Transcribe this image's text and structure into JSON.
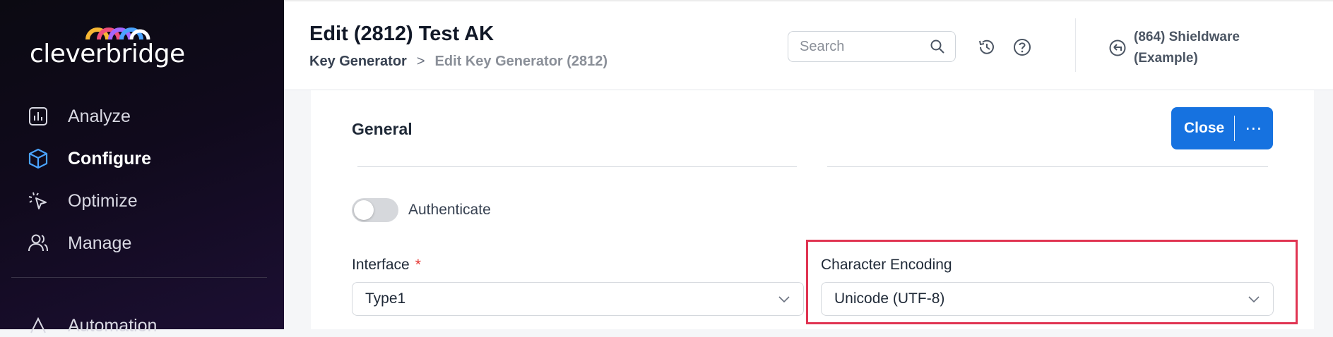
{
  "sidebar": {
    "logo_text": "cleverbridge",
    "items": [
      {
        "label": "Analyze",
        "icon": "bar-chart-icon"
      },
      {
        "label": "Configure",
        "icon": "cube-icon"
      },
      {
        "label": "Optimize",
        "icon": "cursor-click-icon"
      },
      {
        "label": "Manage",
        "icon": "users-icon"
      }
    ],
    "partial_item": "Automation"
  },
  "header": {
    "title": "Edit (2812) Test AK",
    "breadcrumb": [
      "Key Generator",
      "Edit Key Generator (2812)"
    ],
    "breadcrumb_sep": ">",
    "search_placeholder": "Search",
    "account_line1": "(864) Shieldware",
    "account_line2": "(Example)"
  },
  "form": {
    "section_title": "General",
    "close_label": "Close",
    "more_label": "⋯",
    "authenticate_label": "Authenticate",
    "authenticate_on": false,
    "interface_label": "Interface",
    "required_mark": "*",
    "interface_value": "Type1",
    "encoding_label": "Character Encoding",
    "encoding_value": "Unicode (UTF-8)"
  },
  "colors": {
    "accent": "#1672e0",
    "highlight": "#e03452",
    "sidebar_bg": "#0b0a12",
    "configure_icon": "#4aa3ff"
  }
}
